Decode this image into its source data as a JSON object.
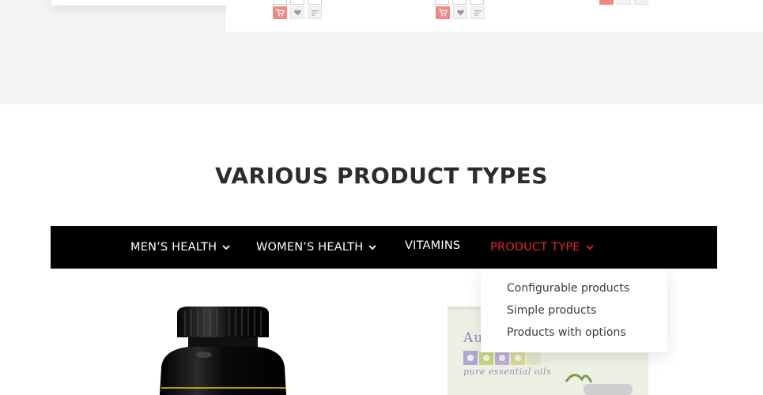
{
  "section": {
    "title": "VARIOUS PRODUCT TYPES"
  },
  "nav": {
    "items": [
      {
        "label": "MEN’S HEALTH",
        "has_dropdown": true,
        "active": false
      },
      {
        "label": "WOMEN’S HEALTH",
        "has_dropdown": true,
        "active": false
      },
      {
        "label": "VITAMINS",
        "has_dropdown": false,
        "active": false
      },
      {
        "label": "PRODUCT TYPE",
        "has_dropdown": true,
        "active": true
      }
    ]
  },
  "dropdown": {
    "items": [
      {
        "label": "Configurable products"
      },
      {
        "label": "Simple products"
      },
      {
        "label": "Products with options"
      }
    ]
  },
  "product_cards": {
    "buttons": [
      "cart-icon",
      "heart-icon",
      "compare-icon"
    ]
  },
  "products_below": [
    {
      "image": "black-supplement-bottle"
    },
    {
      "image": "essential-oils-box",
      "brand_partial": "Au",
      "tagline": "pure essential oils"
    }
  ],
  "colors": {
    "accent_red": "#e8232a",
    "nav_bg": "#000000",
    "cart_button": "#f08a80",
    "band_bg": "#f4f4f4",
    "title_text": "#2c2c2c"
  }
}
